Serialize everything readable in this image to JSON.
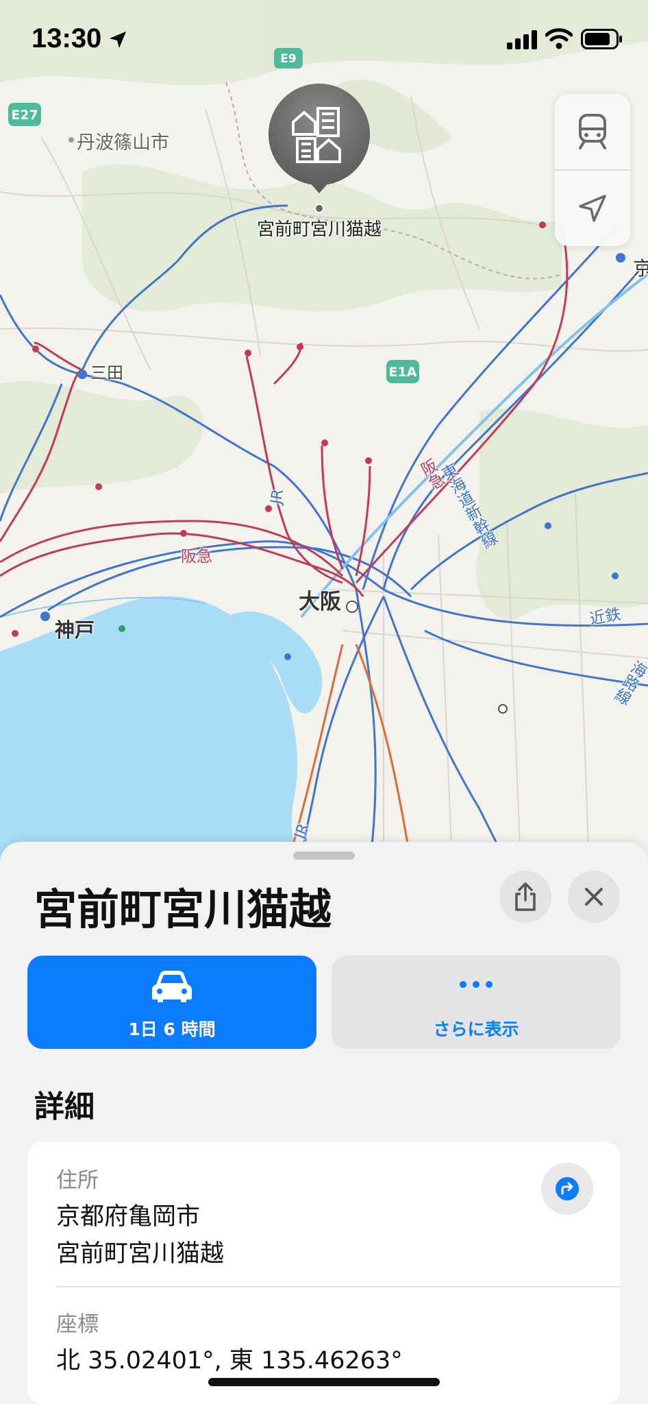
{
  "status_bar": {
    "time": "13:30",
    "icons": [
      "location-arrow-icon",
      "cellular-signal-icon",
      "wifi-icon",
      "battery-icon"
    ]
  },
  "map": {
    "pin_label": "宮前町宮川猫越",
    "pin_icon": "buildings-icon",
    "labels": {
      "tambasasayama": "丹波篠山市",
      "sanda": "三田",
      "osaka": "大阪",
      "kobe": "神戸",
      "hankyu": "阪急",
      "jr": "JR",
      "jr_south": "JR",
      "kintetsu": "近鉄",
      "hankyu_vertical": "阪急",
      "shinkansen": "東海道新幹線",
      "kyo": "京",
      "e27": "E27",
      "e1a": "E1A",
      "e9": "E9",
      "right_edge": "海路線"
    },
    "colors": {
      "water": "#a9dcf5",
      "land": "#f3f2ec",
      "rail": "#3f74d0",
      "private_rail": "#c23a58",
      "highway_shield": "#4fb99c"
    }
  },
  "controls": {
    "transit_icon": "train-icon",
    "location_icon": "location-arrow-outline-icon"
  },
  "sheet": {
    "title": "宮前町宮川猫越",
    "share_icon": "share-icon",
    "close_icon": "close-icon",
    "actions": {
      "drive_label": "1日 6 時間",
      "drive_icon": "car-icon",
      "more_label": "さらに表示",
      "more_icon": "ellipsis-icon"
    },
    "details": {
      "heading": "詳細",
      "address_label": "住所",
      "address_line1": "京都府亀岡市",
      "address_line2": "宮前町宮川猫越",
      "coord_label": "座標",
      "coord_value": "北 35.02401°, 東 135.46263°",
      "directions_icon": "turn-right-arrow-icon"
    },
    "colors": {
      "accent": "#0a7cff"
    }
  }
}
